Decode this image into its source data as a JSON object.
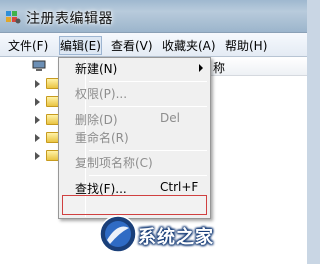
{
  "window": {
    "title": "注册表编辑器"
  },
  "menubar": {
    "items": [
      {
        "label": "文件(F)"
      },
      {
        "label": "编辑(E)"
      },
      {
        "label": "查看(V)"
      },
      {
        "label": "收藏夹(A)"
      },
      {
        "label": "帮助(H)"
      }
    ]
  },
  "list": {
    "column_partial": "称"
  },
  "context_menu": {
    "items": [
      {
        "label": "新建(N)",
        "shortcut": "",
        "enabled": true,
        "submenu": true
      },
      {
        "label": "权限(P)...",
        "shortcut": "",
        "enabled": false
      },
      {
        "label": "删除(D)",
        "shortcut": "Del",
        "enabled": false
      },
      {
        "label": "重命名(R)",
        "shortcut": "",
        "enabled": false
      },
      {
        "label": "复制项名称(C)",
        "shortcut": "",
        "enabled": false
      },
      {
        "label": "查找(F)...",
        "shortcut": "Ctrl+F",
        "enabled": true
      }
    ]
  },
  "watermark": {
    "text": "系统之家"
  },
  "colors": {
    "highlight_border": "#d04040",
    "disabled_text": "#8d8d8d",
    "watermark_blue": "#1a3f79"
  }
}
